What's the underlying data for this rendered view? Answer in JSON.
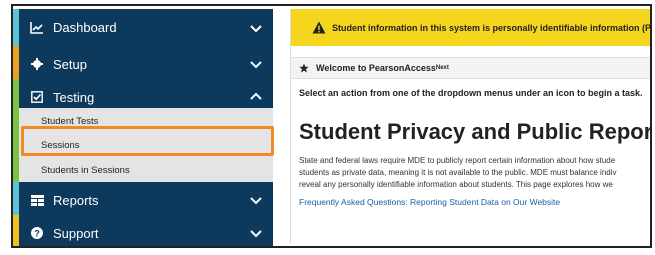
{
  "sidebar": {
    "dashboard": {
      "label": "Dashboard",
      "icon": "dashboard-chart-icon",
      "stripe_color": "#5bc5d6"
    },
    "setup": {
      "label": "Setup",
      "icon": "gear-icon",
      "stripe_color": "#f0a020"
    },
    "testing": {
      "label": "Testing",
      "icon": "checkbox-icon",
      "stripe_color": "#7cc242",
      "expanded": true,
      "items": [
        {
          "label": "Student Tests"
        },
        {
          "label": "Sessions",
          "highlighted": true
        },
        {
          "label": "Students in Sessions"
        }
      ]
    },
    "reports": {
      "label": "Reports",
      "icon": "reports-table-icon",
      "stripe_color": "#5bc5d6"
    },
    "support": {
      "label": "Support",
      "icon": "question-icon",
      "stripe_color": "#f0c020"
    }
  },
  "main": {
    "alert": "Student information in this system is personally identifiable information (PII)",
    "welcome": {
      "text": "Welcome to PearsonAccess",
      "superscript": "Next"
    },
    "instruction": "Select an action from one of the dropdown menus under an icon to begin a task.",
    "title": "Student Privacy and Public Reports",
    "body_lines": [
      "State and federal laws require MDE to publicly report certain information about how stude",
      "students as private data, meaning it is not available to the public. MDE must balance indiv",
      "reveal any personally identifiable information about students. This page explores how we"
    ],
    "faq_link": "Frequently Asked Questions: Reporting Student Data on Our Website"
  },
  "colors": {
    "nav_bg": "#0d3a5c",
    "subnav_bg": "#e4e4e4",
    "highlight": "#f08a24",
    "alert_bg": "#f6d51f",
    "link": "#1a5fa8"
  }
}
